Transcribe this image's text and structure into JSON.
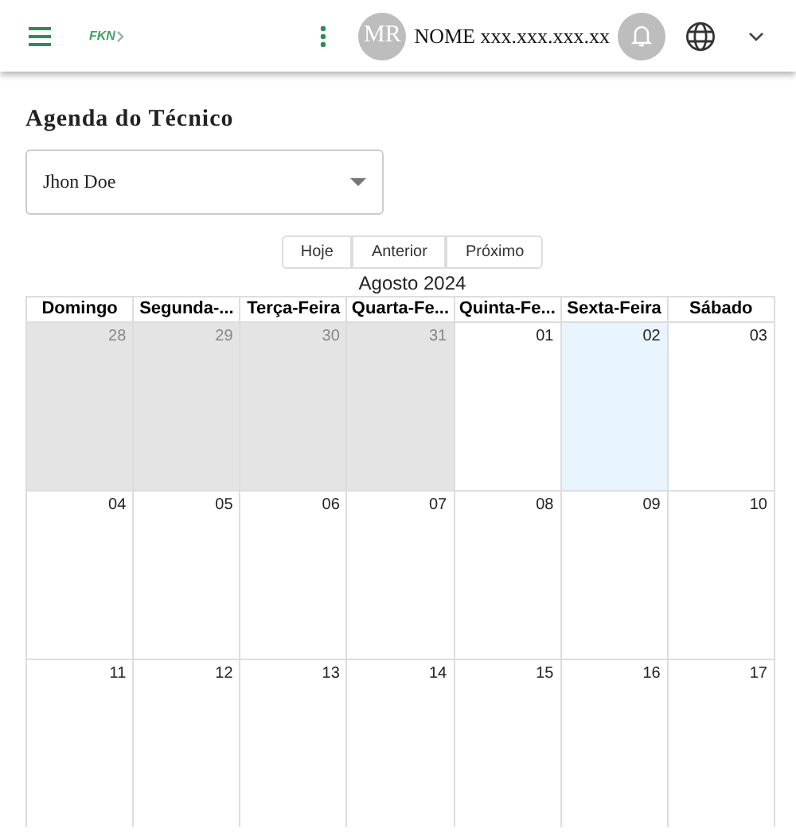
{
  "header": {
    "logo": "FKN",
    "avatar_initials": "MR",
    "user_name": "NOME xxx.xxx.xxx.xx"
  },
  "page_title": "Agenda do Técnico",
  "technician_select": {
    "value": "Jhon Doe"
  },
  "nav_buttons": [
    "Hoje",
    "Anterior",
    "Próximo"
  ],
  "month_label": "Agosto 2024",
  "calendar": {
    "weekdays": [
      "Domingo",
      "Segunda-...",
      "Terça-Feira",
      "Quarta-Fe...",
      "Quinta-Fe...",
      "Sexta-Feira",
      "Sábado"
    ],
    "weeks": [
      [
        {
          "day": "28",
          "other_month": true,
          "today": false
        },
        {
          "day": "29",
          "other_month": true,
          "today": false
        },
        {
          "day": "30",
          "other_month": true,
          "today": false
        },
        {
          "day": "31",
          "other_month": true,
          "today": false
        },
        {
          "day": "01",
          "other_month": false,
          "today": false
        },
        {
          "day": "02",
          "other_month": false,
          "today": true
        },
        {
          "day": "03",
          "other_month": false,
          "today": false
        }
      ],
      [
        {
          "day": "04",
          "other_month": false,
          "today": false
        },
        {
          "day": "05",
          "other_month": false,
          "today": false
        },
        {
          "day": "06",
          "other_month": false,
          "today": false
        },
        {
          "day": "07",
          "other_month": false,
          "today": false
        },
        {
          "day": "08",
          "other_month": false,
          "today": false
        },
        {
          "day": "09",
          "other_month": false,
          "today": false
        },
        {
          "day": "10",
          "other_month": false,
          "today": false
        }
      ],
      [
        {
          "day": "11",
          "other_month": false,
          "today": false
        },
        {
          "day": "12",
          "other_month": false,
          "today": false
        },
        {
          "day": "13",
          "other_month": false,
          "today": false
        },
        {
          "day": "14",
          "other_month": false,
          "today": false
        },
        {
          "day": "15",
          "other_month": false,
          "today": false
        },
        {
          "day": "16",
          "other_month": false,
          "today": false
        },
        {
          "day": "17",
          "other_month": false,
          "today": false
        }
      ]
    ]
  }
}
